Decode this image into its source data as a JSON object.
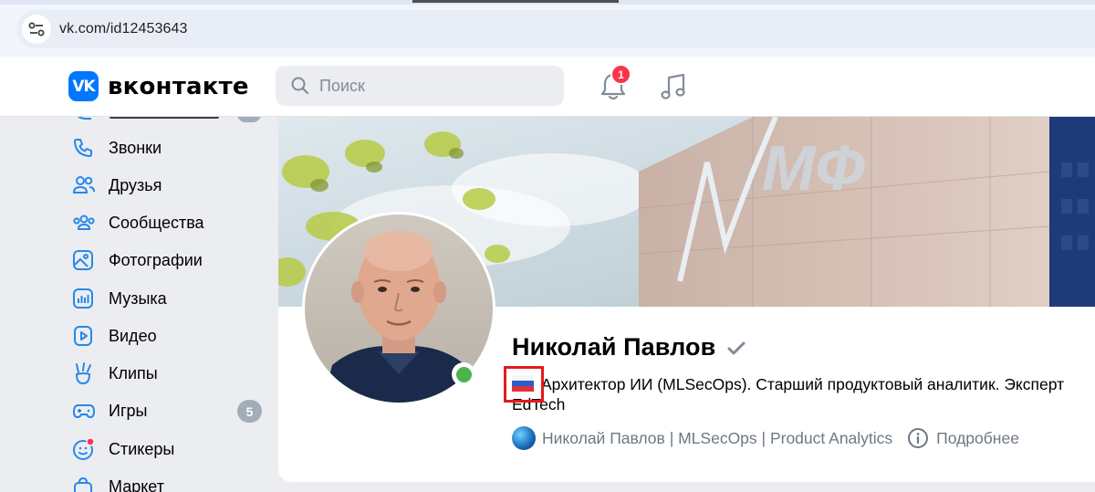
{
  "browser": {
    "url": "vk.com/id12453643"
  },
  "header": {
    "logo_text": "вконтакте",
    "logo_mark": "VK",
    "search_placeholder": "Поиск",
    "notifications_count": "1"
  },
  "sidebar": {
    "items": [
      {
        "label": "Звонки",
        "icon": "phone-icon"
      },
      {
        "label": "Друзья",
        "icon": "friends-icon"
      },
      {
        "label": "Сообщества",
        "icon": "communities-icon"
      },
      {
        "label": "Фотографии",
        "icon": "photos-icon"
      },
      {
        "label": "Музыка",
        "icon": "music-icon"
      },
      {
        "label": "Видео",
        "icon": "video-icon"
      },
      {
        "label": "Клипы",
        "icon": "clips-icon"
      },
      {
        "label": "Игры",
        "icon": "games-icon",
        "badge": "5"
      },
      {
        "label": "Стикеры",
        "icon": "stickers-icon"
      },
      {
        "label": "Маркет",
        "icon": "market-icon"
      }
    ]
  },
  "profile": {
    "name": "Николай Павлов",
    "status": "Архитектор ИИ (MLSecOps). Старший продуктовый аналитик. Эксперт EdTech",
    "community_link": "Николай Павлов | MLSecOps | Product Analytics",
    "details_label": "Подробнее",
    "online": true
  },
  "colors": {
    "vk_blue": "#0077ff",
    "badge_red": "#ff3347",
    "online_green": "#4bb34b",
    "highlight_red": "#e31b1b"
  }
}
